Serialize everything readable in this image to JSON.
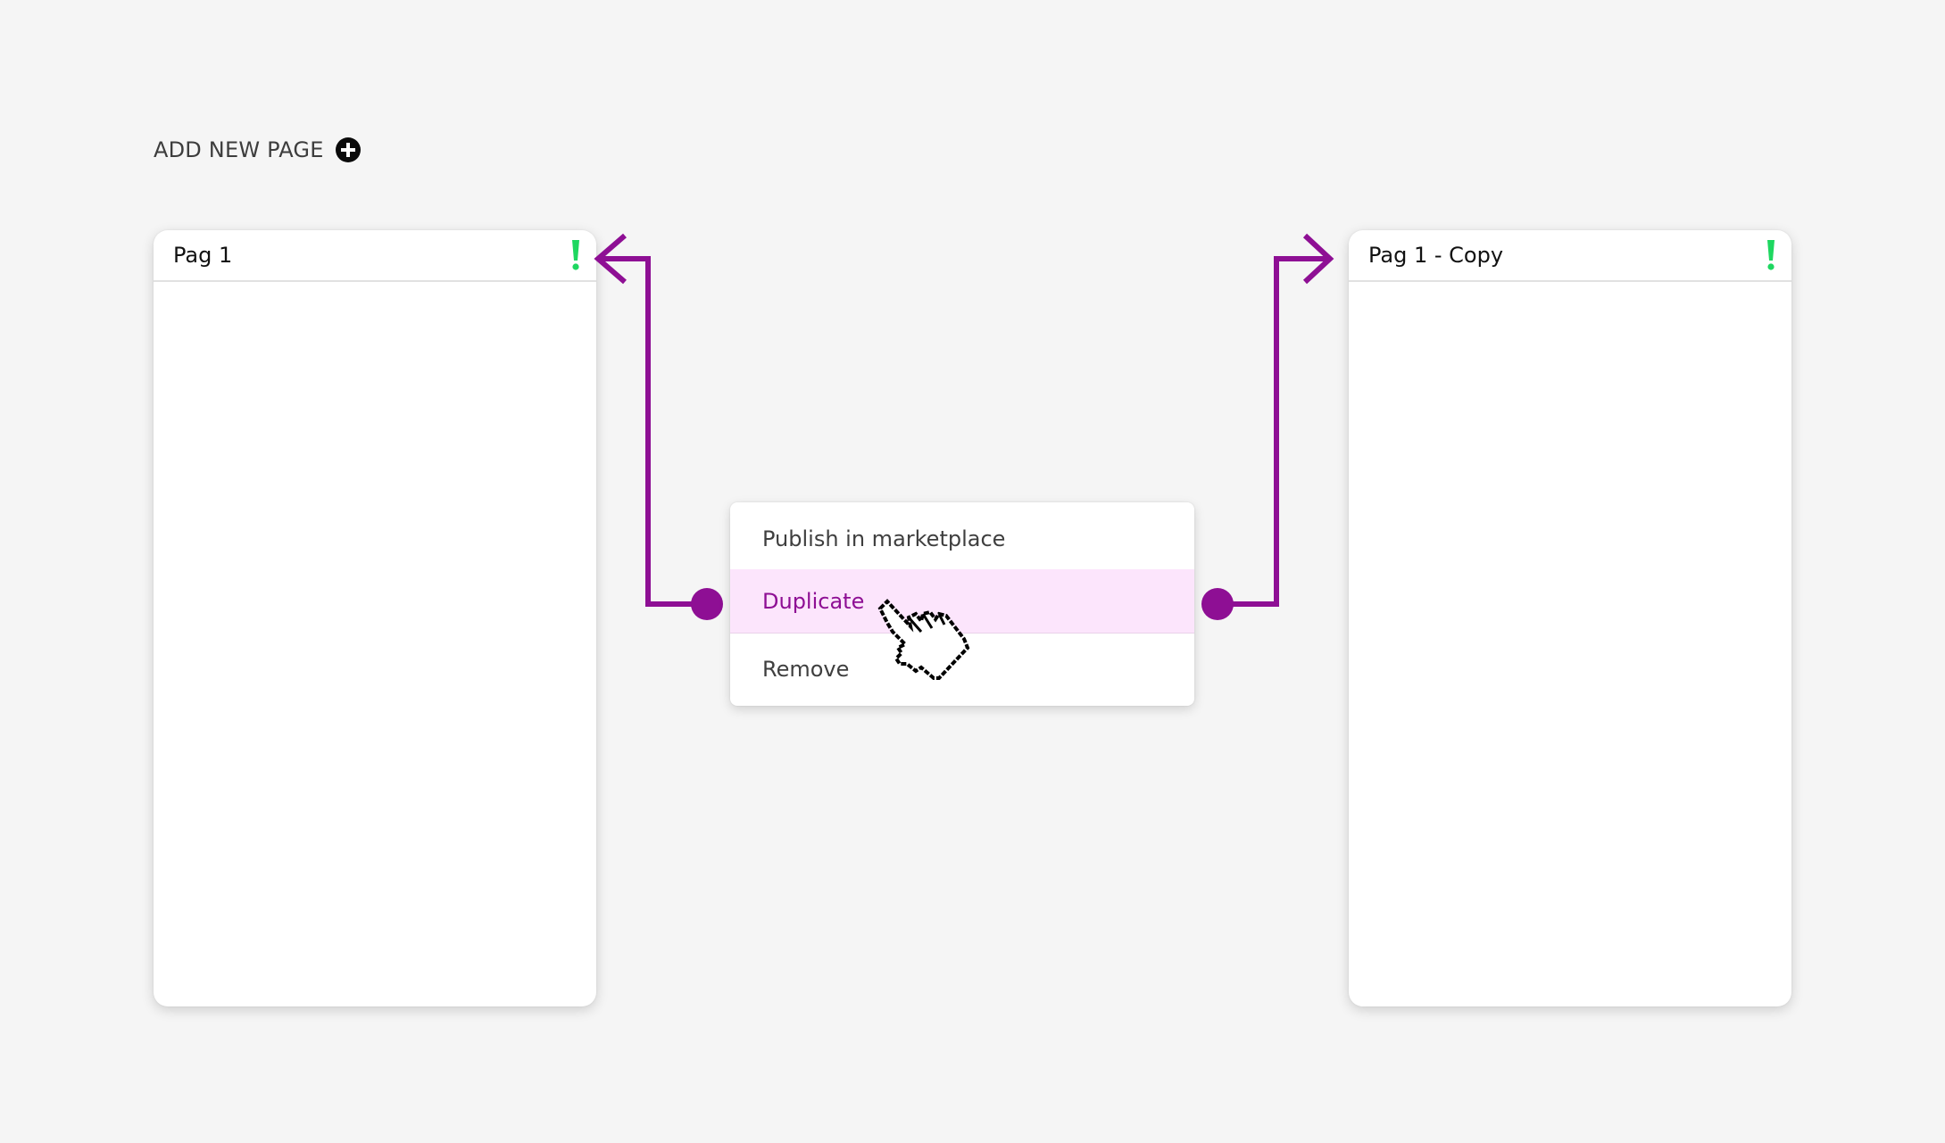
{
  "toolbar": {
    "add_page_label": "ADD NEW PAGE",
    "add_icon": "plus-circle-icon"
  },
  "pages": [
    {
      "title": "Pag 1",
      "status_icon": "exclamation-icon"
    },
    {
      "title": "Pag 1 - Copy",
      "status_icon": "exclamation-icon"
    }
  ],
  "context_menu": {
    "items": [
      {
        "label": "Publish in marketplace",
        "active": false
      },
      {
        "label": "Duplicate",
        "active": true
      },
      {
        "label": "Remove",
        "active": false
      }
    ]
  },
  "colors": {
    "accent": "#8e0f94",
    "highlight_bg": "#fce5fc",
    "warning": "#1ed760",
    "background": "#f5f5f5"
  },
  "cursor_icon": "hand-pointer-icon"
}
